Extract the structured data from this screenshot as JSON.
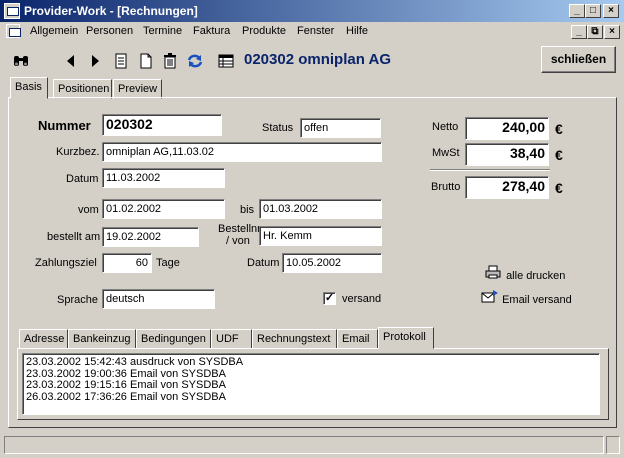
{
  "window": {
    "title": "Provider-Work - [Rechnungen]",
    "controls": [
      "_",
      "□",
      "×"
    ],
    "mdi_controls": [
      "_",
      "⧉",
      "×"
    ]
  },
  "menu": {
    "items": [
      {
        "label": "Allgemein"
      },
      {
        "label": "Personen"
      },
      {
        "label": "Termine"
      },
      {
        "label": "Faktura"
      },
      {
        "label": "Produkte"
      },
      {
        "label": "Fenster"
      },
      {
        "label": "Hilfe"
      }
    ]
  },
  "toolbar": {
    "icons": {
      "search": "binoculars-icon",
      "prev": "arrow-left-icon",
      "next": "arrow-right-icon",
      "report": "document-list-icon",
      "new": "new-document-icon",
      "delete": "trash-icon",
      "refresh": "refresh-icon",
      "detail": "table-icon"
    },
    "record_title": "020302 omniplan AG",
    "close_label": "schließen"
  },
  "tabs": {
    "main": [
      "Basis",
      "Positionen",
      "Preview"
    ],
    "active": "Basis"
  },
  "form": {
    "nummer_label": "Nummer",
    "nummer_value": "020302",
    "status_label": "Status",
    "status_value": "offen",
    "kurzbez_label": "Kurzbez.",
    "kurzbez_value": "omniplan AG,11.03.02",
    "datum_label": "Datum",
    "datum_value": "11.03.2002",
    "vom_label": "vom",
    "vom_value": "01.02.2002",
    "bis_label": "bis",
    "bis_value": "01.03.2002",
    "bestellt_label": "bestellt am",
    "bestellt_value": "19.02.2002",
    "bestellnr_label_1": "Bestellnr",
    "bestellnr_label_2": "/ von",
    "bestellnr_value": "Hr. Kemm",
    "zahlungsziel_label": "Zahlungsziel",
    "zahlungsziel_value": "60",
    "tage_label": "Tage",
    "datum2_label": "Datum",
    "datum2_value": "10.05.2002",
    "sprache_label": "Sprache",
    "sprache_value": "deutsch",
    "versand_label": "versand",
    "versand_checked": "✓"
  },
  "totals": {
    "netto_label": "Netto",
    "netto_value": "240,00",
    "mwst_label": "MwSt",
    "mwst_value": "38,40",
    "brutto_label": "Brutto",
    "brutto_value": "278,40",
    "currency": "€"
  },
  "actions": {
    "print_all": "alle drucken",
    "email_send": "Email versand",
    "print_icon": "printer-icon",
    "email_icon": "email-send-icon"
  },
  "subtabs": {
    "items": [
      "Adresse",
      "Bankeinzug",
      "Bedingungen",
      "UDF",
      "Rechnungstext",
      "Email",
      "Protokoll"
    ],
    "active": "Protokoll"
  },
  "log": [
    "23.03.2002 15:42:43 ausdruck von SYSDBA",
    "23.03.2002 19:00:36 Email von SYSDBA",
    "23.03.2002 19:15:16 Email von SYSDBA",
    "26.03.2002 17:36:26 Email von SYSDBA"
  ],
  "colors": {
    "titlebar_start": "#0a246a",
    "titlebar_end": "#a6caf0",
    "face": "#d4d0c8",
    "record_title": "#0a246a"
  }
}
